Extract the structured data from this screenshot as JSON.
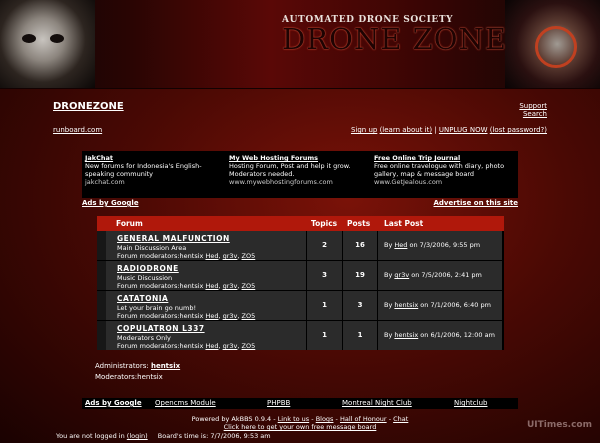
{
  "banner": {
    "society": "AUTOMATED DRONE SOCIETY",
    "title": "DRONE ZONE"
  },
  "header": {
    "site_name": "DRONEZONE",
    "support": "Support",
    "search": "Search",
    "host_link": "runboard.com",
    "sign_up": "Sign up",
    "learn_about": "(learn about it)",
    "separator": "|",
    "unplug": "UNPLUG NOW",
    "lost_password": "(lost password?)"
  },
  "ads_top": {
    "items": [
      {
        "title": "JakChat",
        "text": "New forums for Indonesia's English-speaking community",
        "url": "jakchat.com"
      },
      {
        "title": "My Web Hosting Forums",
        "text": "Hosting Forum, Post and help it grow. Moderators needed.",
        "url": "www.mywebhostingforums.com"
      },
      {
        "title": "Free Online Trip Journal",
        "text": "Free online travelogue with diary, photo gallery, map & message board",
        "url": "www.GetJealous.com"
      }
    ],
    "by_google": "Ads by Google",
    "advertise": "Advertise on this site"
  },
  "forum_table": {
    "headers": {
      "forum": "Forum",
      "topics": "Topics",
      "posts": "Posts",
      "last_post": "Last Post"
    },
    "moderators_label": "Forum moderators:hentsix",
    "mod_links": [
      "Hed",
      "gr3v",
      "ZO5"
    ],
    "rows": [
      {
        "name": "GENERAL MALFUNCTION",
        "desc": "Main Discussion Area",
        "topics": "2",
        "posts": "16",
        "by": "By",
        "author": "Hed",
        "date": "on 7/3/2006, 9:55 pm"
      },
      {
        "name": "RADIODRONE",
        "desc": "Music Discussion",
        "topics": "3",
        "posts": "19",
        "by": "By",
        "author": "gr3v",
        "date": "on 7/5/2006, 2:41 pm"
      },
      {
        "name": "CATATONIA",
        "desc": "Let your brain go numb!",
        "topics": "1",
        "posts": "3",
        "by": "By",
        "author": "hentsix",
        "date": "on 7/1/2006, 6:40 pm"
      },
      {
        "name": "COPULATRON L337",
        "desc": "Moderators Only",
        "topics": "1",
        "posts": "1",
        "by": "By",
        "author": "hentsix",
        "date": "on 6/1/2006, 12:00 am"
      }
    ]
  },
  "admin": {
    "admins_label": "Administrators:",
    "admin_name": "hentsix",
    "moderators_label": "Moderators:hentsix"
  },
  "bottom_ads": {
    "by_google": "Ads by Google",
    "links": [
      "Opencms Module",
      "PHPBB",
      "Montreal Night Club",
      "Nightclub"
    ]
  },
  "footer": {
    "powered": "Powered by AkBBS 0.9.4",
    "links": [
      "Link to us",
      "Blogs",
      "Hall of Honour",
      "Chat"
    ],
    "dash": "-",
    "cta": "Click here to get your own free message board",
    "not_logged": "You are not logged in",
    "login": "(login)",
    "board_time": "Board's time is: 7/7/2006, 9:53 am"
  },
  "watermark": "UITimes.com"
}
